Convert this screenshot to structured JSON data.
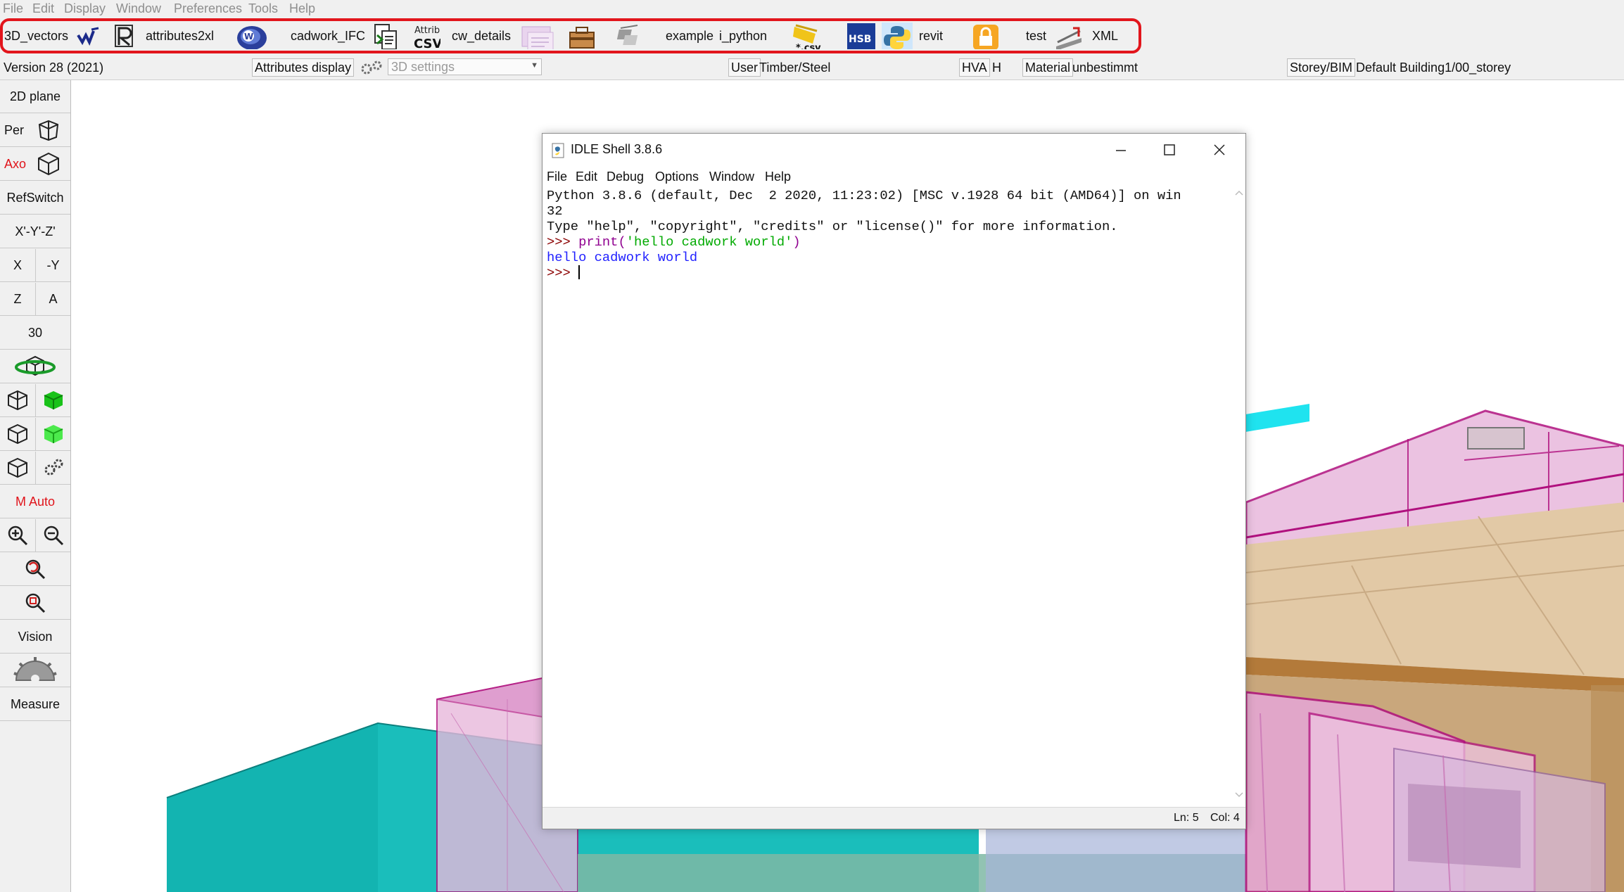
{
  "menubar": {
    "items": [
      "File",
      "Edit",
      "Display",
      "Window",
      "Preferences",
      "Tools",
      "Help"
    ]
  },
  "toolbar": {
    "items": [
      {
        "label": "3D_vectors",
        "icon": "cw-wave-icon"
      },
      {
        "label": "attributes2xl",
        "icon": "r-logo-icon"
      },
      {
        "label": "cadwork_IFC",
        "icon": "cadwork-globe-icon"
      },
      {
        "label": "cw_details",
        "icon": "attrib-csv-icon"
      },
      {
        "label": "",
        "icon": "csv-card-icon"
      },
      {
        "label": "",
        "icon": "toolbox-icon"
      },
      {
        "label": "example",
        "icon": "bim-icon"
      },
      {
        "label": "i_python",
        "icon": "csv-folder-icon"
      },
      {
        "label": "",
        "icon": "hsbcad-icon"
      },
      {
        "label": "revit",
        "icon": "python-logo-icon"
      },
      {
        "label": "test",
        "icon": "lock-icon"
      },
      {
        "label": "XML",
        "icon": "python-script-icon"
      }
    ],
    "icon_texts": {
      "attrib": "Attrib",
      "csv": "CSV",
      "star_csv": "*.csv",
      "hsb": "HSB"
    }
  },
  "statusbar": {
    "version": "Version 28 (2021)",
    "attributes_display": "Attributes display",
    "settings_combo": "3D settings",
    "user_label": "User",
    "user_value": "Timber/Steel",
    "hva_label": "HVA",
    "hva_value": "H",
    "material_label": "Material",
    "material_value": "unbestimmt",
    "storey_label": "Storey/BIM",
    "storey_value": "Default Building1/00_storey"
  },
  "leftpanel": {
    "plane": "2D plane",
    "per": "Per",
    "axo": "Axo",
    "refswitch": "RefSwitch",
    "xyz": "X'-Y'-Z'",
    "x": "X",
    "neg_y": "-Y",
    "z": "Z",
    "a": "A",
    "angle": "30",
    "m_auto": "M Auto",
    "vision": "Vision",
    "measure": "Measure"
  },
  "idle": {
    "title": "IDLE Shell 3.8.6",
    "menu": [
      "File",
      "Edit",
      "Debug",
      "Options",
      "Window",
      "Help"
    ],
    "banner_line1": "Python 3.8.6 (default, Dec  2 2020, 11:23:02) [MSC v.1928 64 bit (AMD64)] on win",
    "banner_line2": "32",
    "banner_line3": "Type \"help\", \"copyright\", \"credits\" or \"license()\" for more information.",
    "prompt": ">>> ",
    "command_func": "print(",
    "command_str": "'hello cadwork world'",
    "command_close": ")",
    "output": "hello cadwork world",
    "status_ln": "Ln: 5",
    "status_col": "Col: 4"
  },
  "colors": {
    "highlight_border": "#e2151c",
    "prompt": "#8b0000",
    "keyword": "#900090",
    "string": "#00aa00",
    "output": "#1f1fff",
    "axo_red": "#e0141b",
    "model_magenta": "#c0138f",
    "model_teal": "#0fb3b3"
  }
}
